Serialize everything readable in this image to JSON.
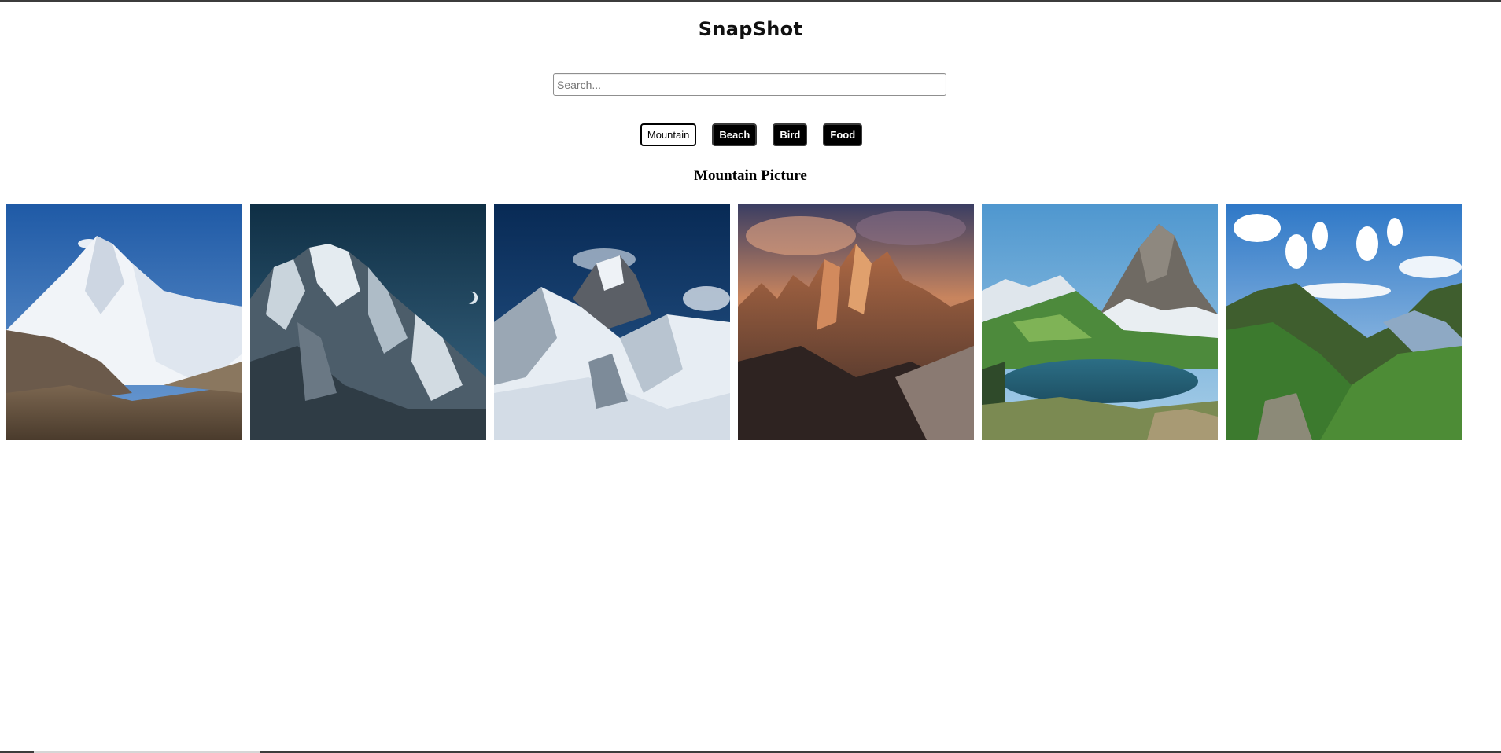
{
  "app": {
    "title": "SnapShot"
  },
  "search": {
    "placeholder": "Search...",
    "value": ""
  },
  "categories": [
    {
      "label": "Mountain",
      "active": true
    },
    {
      "label": "Beach",
      "active": false
    },
    {
      "label": "Bird",
      "active": false
    },
    {
      "label": "Food",
      "active": false
    }
  ],
  "gallery": {
    "heading": "Mountain Picture",
    "photos": [
      {
        "subject": "snow-covered mountain peak under blue sky"
      },
      {
        "subject": "rocky snowy mountain ridges at dusk with moon"
      },
      {
        "subject": "everest peak with snowy foreground"
      },
      {
        "subject": "jagged peaks lit by orange sunset"
      },
      {
        "subject": "pyramid mountain above alpine lake"
      },
      {
        "subject": "green valley between mountains with clouds"
      }
    ]
  },
  "colors": {
    "button_active_bg": "#ffffff",
    "button_bg": "#000000",
    "button_text": "#ffffff",
    "frame": "#3c3c3c"
  }
}
